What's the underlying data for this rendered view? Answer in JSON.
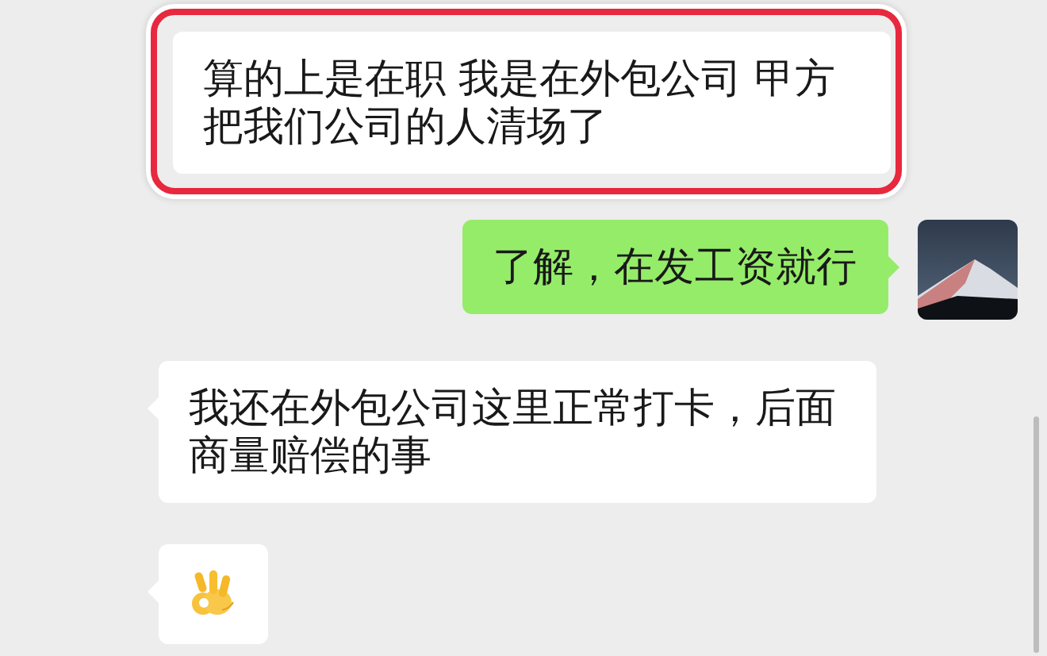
{
  "messages": [
    {
      "outgoing": false,
      "kind": "text",
      "text": "算的上是在职 我是在外包公司 甲方把我们公司的人清场了",
      "highlighted": true
    },
    {
      "outgoing": true,
      "kind": "text",
      "text": "了解，在发工资就行",
      "highlighted": false
    },
    {
      "outgoing": false,
      "kind": "text",
      "text": "我还在外包公司这里正常打卡，后面商量赔偿的事",
      "highlighted": false
    },
    {
      "outgoing": false,
      "kind": "emoji",
      "highlighted": false
    }
  ]
}
